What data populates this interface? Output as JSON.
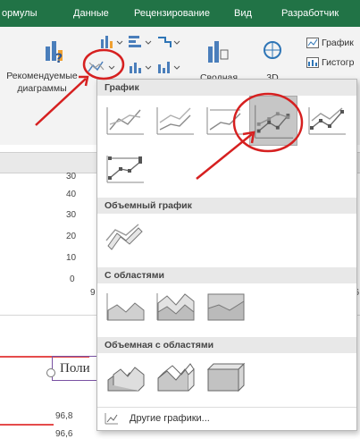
{
  "ribbon": {
    "tabs": [
      "ормулы",
      "Данные",
      "Рецензирование",
      "Вид",
      "Разработчик"
    ],
    "recommended_label_line1": "Рекомендуемые",
    "recommended_label_line2": "диаграммы",
    "pivot_label": "Сводная",
    "map3d_label": "3D",
    "sparklines": [
      "График",
      "Гистогр"
    ]
  },
  "sheet": {
    "axis_values": [
      "30",
      "40",
      "30",
      "20",
      "10",
      "0"
    ],
    "x_left": "9",
    "x_right": "96",
    "title_left": "Поли",
    "values_bottom": [
      "96,8",
      "96,6"
    ]
  },
  "menu": {
    "sections": {
      "line": "График",
      "line3d": "Объемный график",
      "area": "С областями",
      "area3d": "Объемная с областями"
    },
    "more_label": "Другие графики..."
  },
  "colors": {
    "excel_green": "#217346",
    "annotation_red": "#d62020",
    "selected_bg": "#c6c6c6"
  }
}
